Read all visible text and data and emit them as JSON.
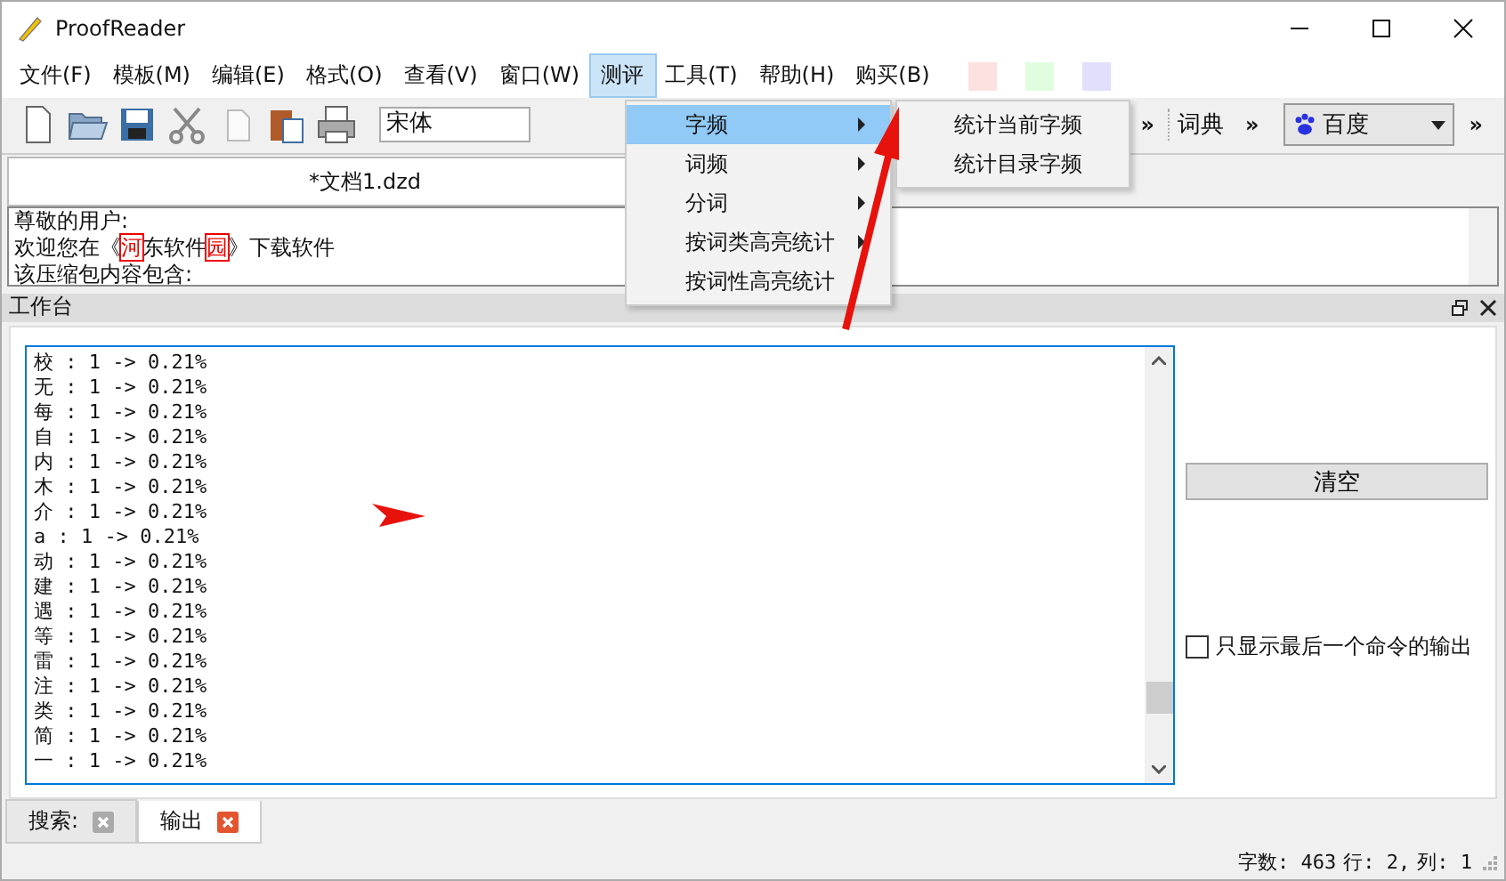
{
  "window": {
    "title": "ProofReader"
  },
  "menubar": {
    "items": [
      {
        "label": "文件(F)",
        "selected": false
      },
      {
        "label": "模板(M)",
        "selected": false
      },
      {
        "label": "编辑(E)",
        "selected": false
      },
      {
        "label": "格式(O)",
        "selected": false
      },
      {
        "label": "查看(V)",
        "selected": false
      },
      {
        "label": "窗口(W)",
        "selected": false
      },
      {
        "label": "测评",
        "selected": true
      },
      {
        "label": "工具(T)",
        "selected": false
      },
      {
        "label": "帮助(H)",
        "selected": false
      },
      {
        "label": "购买(B)",
        "selected": false
      }
    ],
    "swatches": [
      {
        "color": "#fde0e0"
      },
      {
        "color": "#e0fde0"
      },
      {
        "color": "#e0e0fd"
      }
    ]
  },
  "toolbar": {
    "font": "宋体",
    "more": "»",
    "dictionary": "词典",
    "search_engine": "百度"
  },
  "menu": {
    "items": [
      {
        "label": "字频",
        "submenu": true,
        "selected": true
      },
      {
        "label": "词频",
        "submenu": true,
        "selected": false
      },
      {
        "label": "分词",
        "submenu": true,
        "selected": false
      },
      {
        "label": "按词类高亮统计",
        "submenu": true,
        "selected": false
      },
      {
        "label": "按词性高亮统计",
        "submenu": false,
        "selected": false
      }
    ],
    "submenu": [
      "统计当前字频",
      "统计目录字频"
    ]
  },
  "document": {
    "title": "*文档1.dzd",
    "lines": [
      [
        {
          "text": "尊敬的用户:",
          "highlight": false
        }
      ],
      [
        {
          "text": "欢迎您在《",
          "highlight": false
        },
        {
          "text": "河",
          "highlight": true
        },
        {
          "text": "东软件",
          "highlight": false
        },
        {
          "text": "园",
          "highlight": true
        },
        {
          "text": "》下载软件",
          "highlight": false
        }
      ],
      [
        {
          "text": "该压缩包内容包含:",
          "highlight": false
        }
      ]
    ]
  },
  "workbench": {
    "title": "工作台",
    "output": [
      "校 : 1 -> 0.21%",
      "无 : 1 -> 0.21%",
      "每 : 1 -> 0.21%",
      "自 : 1 -> 0.21%",
      "内 : 1 -> 0.21%",
      "木 : 1 -> 0.21%",
      "介 : 1 -> 0.21%",
      "a : 1 -> 0.21%",
      "动 : 1 -> 0.21%",
      "建 : 1 -> 0.21%",
      "遇 : 1 -> 0.21%",
      "等 : 1 -> 0.21%",
      "雷 : 1 -> 0.21%",
      "注 : 1 -> 0.21%",
      "类 : 1 -> 0.21%",
      "简 : 1 -> 0.21%",
      "一 : 1 -> 0.21%"
    ],
    "clear_button": "清空",
    "last_only": {
      "label": "只显示最后一个命令的输出",
      "checked": false
    }
  },
  "bottom_tabs": [
    {
      "label": "搜索:",
      "selected": false
    },
    {
      "label": "输出",
      "selected": true
    }
  ],
  "status_bar": {
    "chars": "字数: 463",
    "line": "行: 2,",
    "column": "列: 1"
  }
}
